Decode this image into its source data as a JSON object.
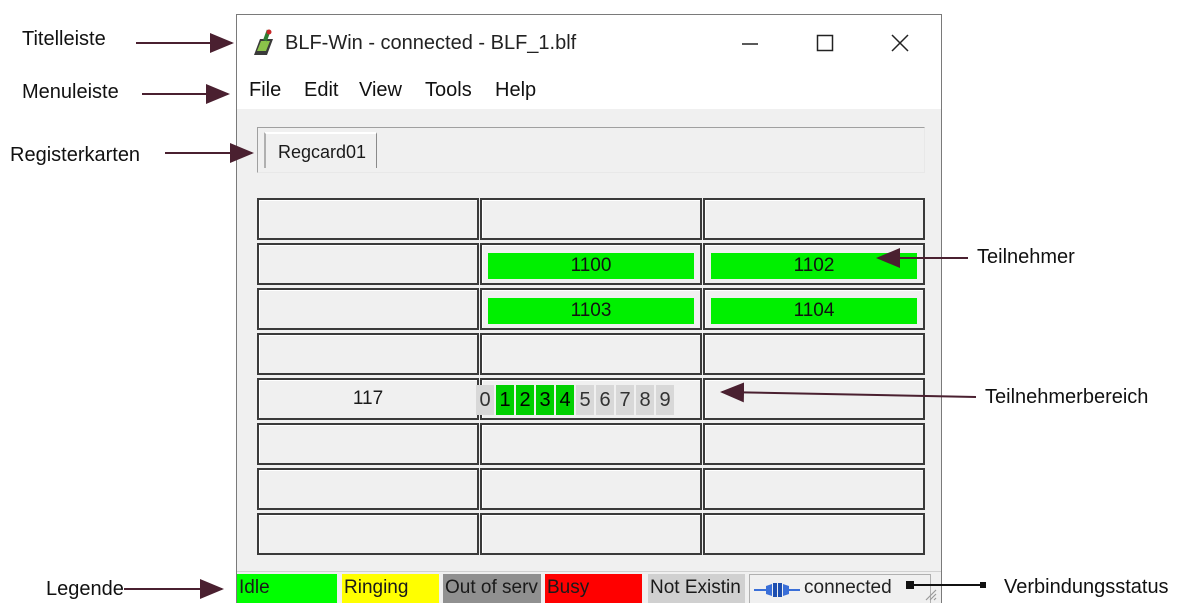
{
  "window": {
    "title": "BLF-Win - connected - BLF_1.blf",
    "controls": [
      "minimize",
      "maximize",
      "close"
    ]
  },
  "menu": [
    "File",
    "Edit",
    "View",
    "Tools",
    "Help"
  ],
  "tabs": [
    "Regcard01"
  ],
  "grid": {
    "rows": [
      [
        "",
        "",
        ""
      ],
      [
        "",
        "1100",
        "1102"
      ],
      [
        "",
        "1103",
        "1104"
      ],
      [
        "",
        "",
        ""
      ],
      [
        "117",
        "digits",
        ""
      ],
      [
        "",
        "",
        ""
      ],
      [
        "",
        "",
        ""
      ],
      [
        "",
        "",
        ""
      ]
    ],
    "digits": [
      {
        "d": "0",
        "on": false
      },
      {
        "d": "1",
        "on": true
      },
      {
        "d": "2",
        "on": true
      },
      {
        "d": "3",
        "on": true
      },
      {
        "d": "4",
        "on": true
      },
      {
        "d": "5",
        "on": false
      },
      {
        "d": "6",
        "on": false
      },
      {
        "d": "7",
        "on": false
      },
      {
        "d": "8",
        "on": false
      },
      {
        "d": "9",
        "on": false
      }
    ]
  },
  "legend": [
    {
      "label": "Idle",
      "color": "#00ff00"
    },
    {
      "label": "Ringing",
      "color": "#ffff00"
    },
    {
      "label": "Out of serv",
      "color": "#909090"
    },
    {
      "label": "Busy",
      "color": "#ff0000"
    },
    {
      "label": "Not Existin",
      "color": "#d0d0d0"
    }
  ],
  "connection": {
    "label": "connected",
    "icon": "plug-icon"
  },
  "annotations": {
    "titelleiste": "Titelleiste",
    "menuleiste": "Menuleiste",
    "registerkarten": "Registerkarten",
    "teilnehmer": "Teilnehmer",
    "teilnehmerbereich": "Teilnehmerbereich",
    "legende": "Legende",
    "verbindungsstatus": "Verbindungsstatus"
  },
  "colors": {
    "subscriber_idle": "#00f000",
    "arrow": "#4a2030"
  }
}
